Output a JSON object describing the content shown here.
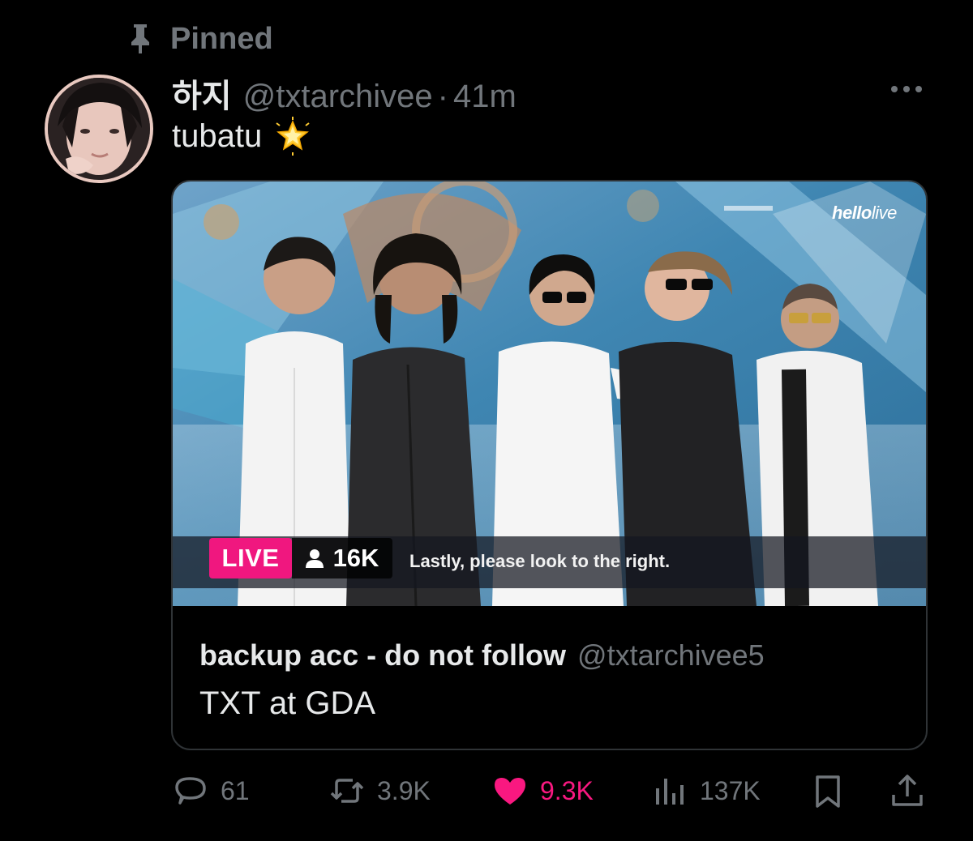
{
  "pinned": {
    "label": "Pinned",
    "icon": "pin-icon"
  },
  "tweet": {
    "display_name": "하지",
    "handle": "@txtarchivee",
    "separator": "·",
    "time": "41m",
    "text": "tubatu",
    "emoji_icon": "glowing-star-icon"
  },
  "quote": {
    "media": {
      "live_label": "LIVE",
      "viewer_count": "16K",
      "caption": "Lastly, please look to the right.",
      "brand_bold": "hello",
      "brand_light": "live"
    },
    "author": "backup acc - do not follow",
    "handle": "@txtarchivee5",
    "text": "TXT at GDA"
  },
  "actions": {
    "replies": "61",
    "reposts": "3.9K",
    "likes": "9.3K",
    "views": "137K",
    "liked": true
  },
  "colors": {
    "background": "#000000",
    "primary_text": "#e7e9ea",
    "secondary_text": "#71767b",
    "like": "#f91880",
    "live_badge": "#f0177f",
    "border": "#2f3336"
  }
}
